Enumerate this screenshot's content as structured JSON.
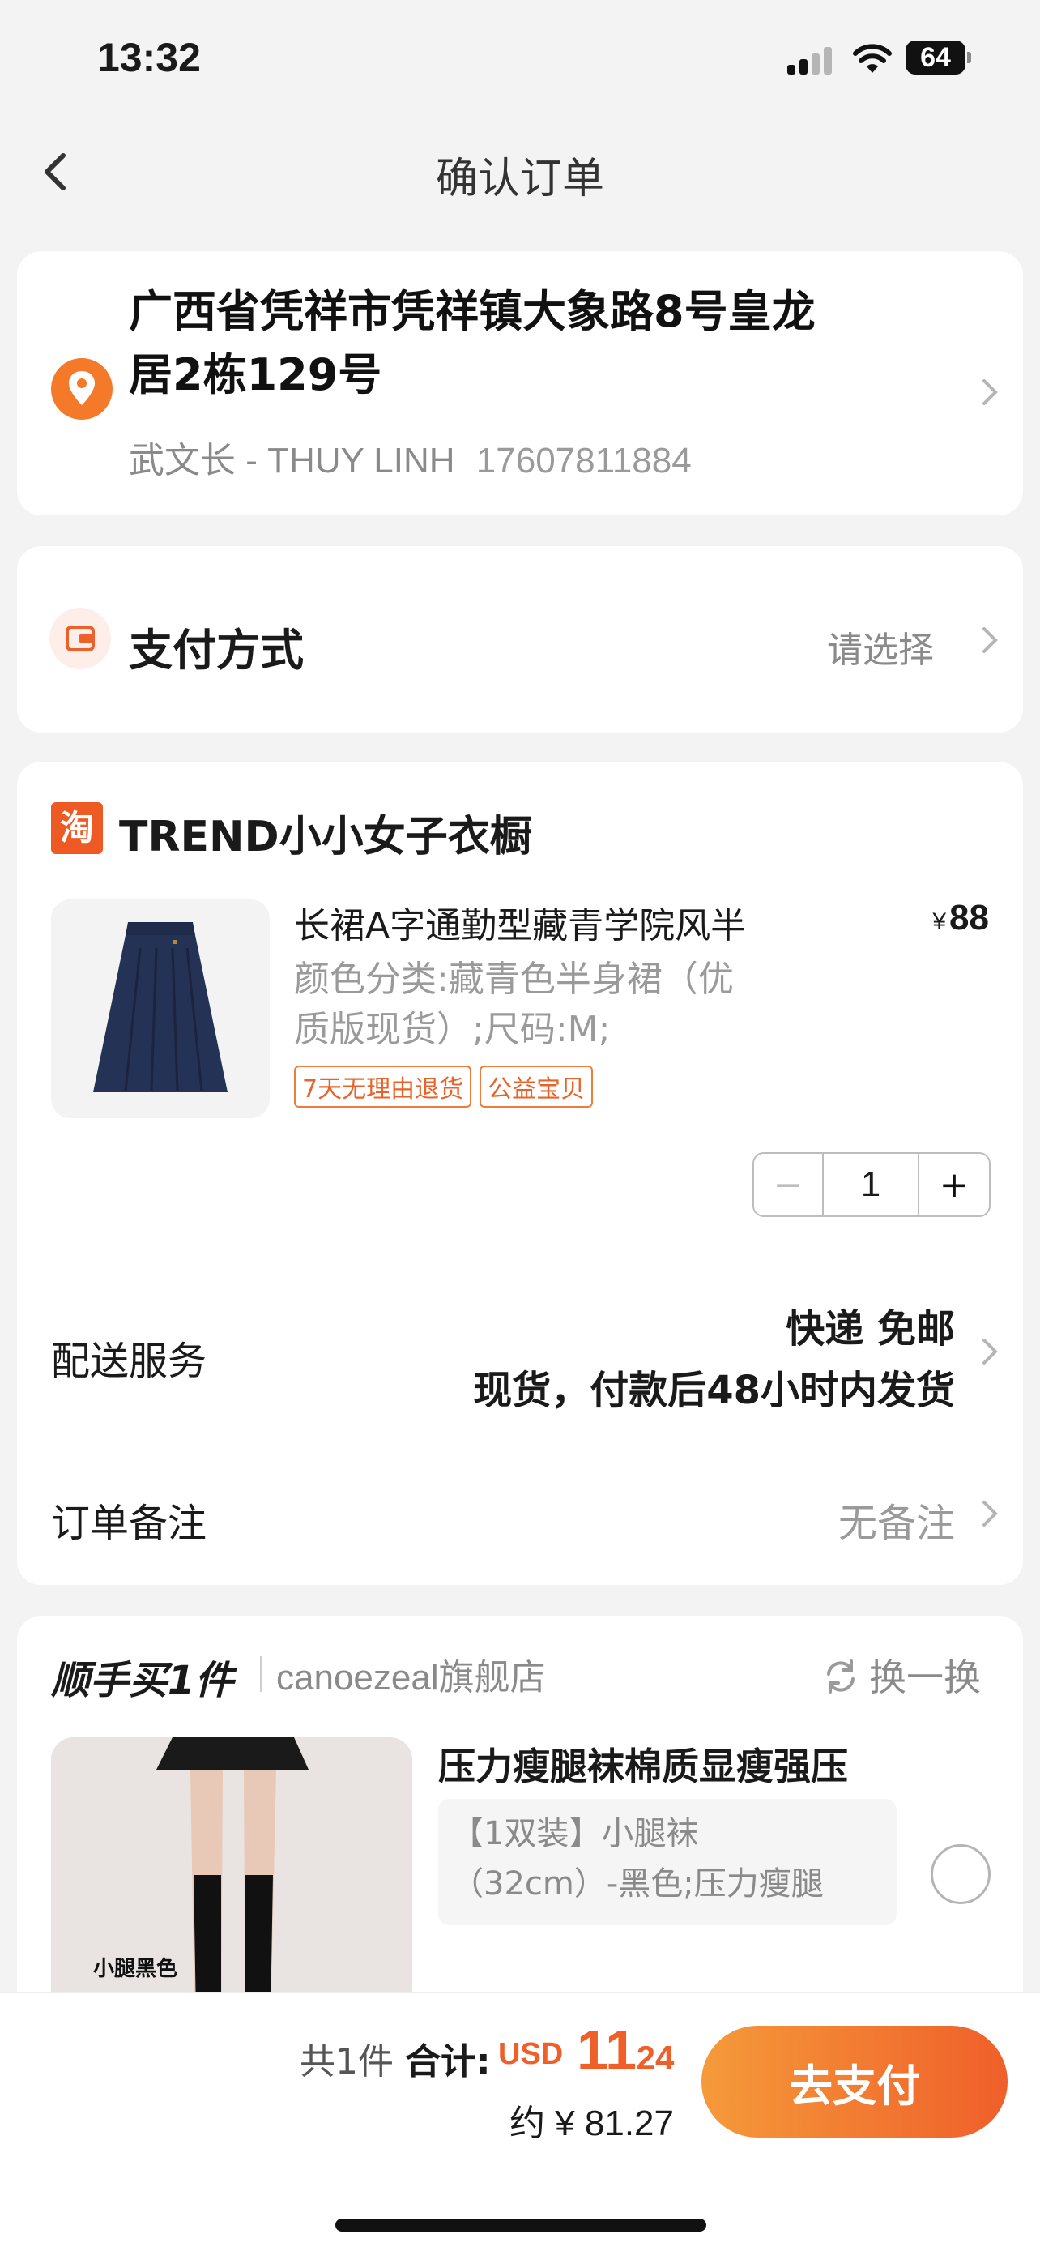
{
  "status": {
    "time": "13:32",
    "battery": "64"
  },
  "nav": {
    "title": "确认订单"
  },
  "address": {
    "line1": "广西省凭祥市凭祥镇大象路8号皇龙",
    "line2": "居2栋129号",
    "recipient": "武文长 - THUY LINH",
    "phone": "17607811884"
  },
  "payment": {
    "label": "支付方式",
    "value": "请选择"
  },
  "order": {
    "shop_icon": "淘",
    "shop_name": "TREND小小女子衣橱",
    "product": {
      "title": "长裙A字通勤型藏青学院风半",
      "currency": "¥",
      "price": "88",
      "spec_line1": "颜色分类:藏青色半身裙（优",
      "spec_line2": "质版现货）;尺码:M;",
      "tags": [
        "7天无理由退货",
        "公益宝贝"
      ],
      "quantity": "1"
    },
    "shipping": {
      "label": "配送服务",
      "line1": "快递 免邮",
      "line2": "现货，付款后48小时内发货"
    },
    "note": {
      "label": "订单备注",
      "value": "无备注"
    }
  },
  "addon": {
    "title": "顺手买1件",
    "store": "canoezeal旗舰店",
    "swap": "换一换",
    "name": "压力瘦腿袜棉质显瘦强压",
    "spec_line1": "【1双装】小腿袜",
    "spec_line2": "（32cm）-黑色;压力瘦腿",
    "image_label": "小腿黑色"
  },
  "footer": {
    "count": "共1件",
    "total_label": "合计:",
    "currency": "USD",
    "total_int": "11",
    "total_dec": ".24",
    "approx": "约 ¥ 81.27",
    "pay_button": "去支付"
  },
  "icons": {
    "back": "chevron-left-icon",
    "location": "location-pin-icon",
    "wallet": "wallet-icon",
    "chevron": "chevron-right-icon",
    "swap": "refresh-icon"
  },
  "colors": {
    "accent": "#ef5f2a",
    "accent_light": "#f59a3a",
    "muted": "#8a8a8a"
  }
}
